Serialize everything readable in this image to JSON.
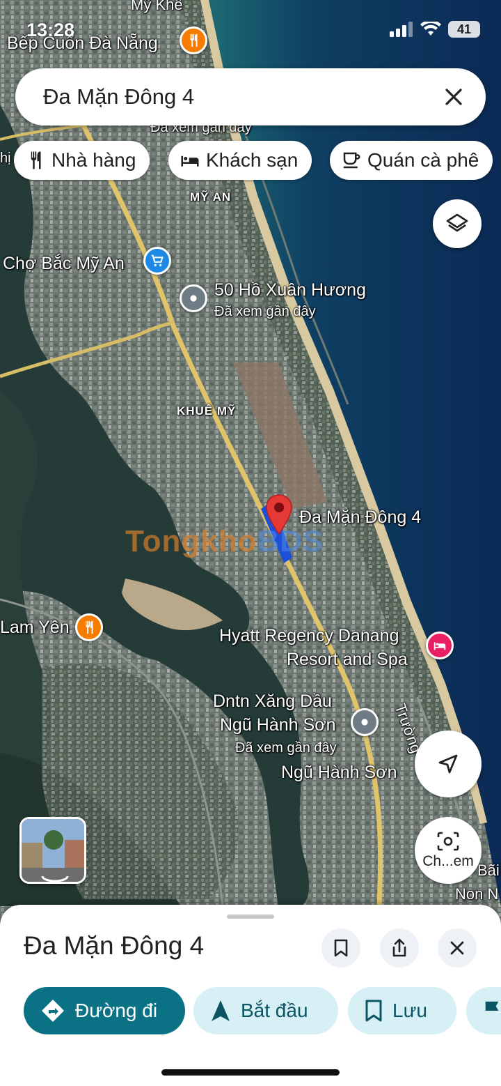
{
  "status_bar": {
    "time": "13:28",
    "battery": "41"
  },
  "search": {
    "query": "Đa Mặn Đông 4"
  },
  "chips": [
    {
      "label": "Nhà hàng",
      "icon": "restaurant-icon"
    },
    {
      "label": "Khách sạn",
      "icon": "hotel-icon"
    },
    {
      "label": "Quán cà phê",
      "icon": "coffee-icon"
    }
  ],
  "map": {
    "places": {
      "bep_cuon": "Bếp Cuốn Đà Nẵng",
      "my_khe": "Mỹ Khê",
      "cho_bac_my_an": "Chợ Bắc Mỹ An",
      "ho_xuan_huong": "50 Hồ Xuân Hương",
      "seen_recent": "Đã xem gần đây",
      "dropped_pin": "Đa Mặn Đông 4",
      "lam_yen": "Lam Yên",
      "hyatt_line1": "Hyatt Regency Danang",
      "hyatt_line2": "Resort and Spa",
      "xang_dau_line1": "Dntn Xăng Dầu",
      "xang_dau_line2": "Ngũ Hành Sơn",
      "ngu_hanh_son": "Ngũ Hành Sơn",
      "truong": "Trường",
      "bai": "Bãi",
      "non_n": "Non N",
      "partial_left": "hị"
    },
    "districts": {
      "my_an": "MỸ AN",
      "khue_my": "KHUÊ MỸ"
    },
    "watermark": {
      "part1": "Tongkho",
      "part2": "BDS"
    },
    "lens_label": "Ch...em"
  },
  "sheet": {
    "title": "Đa Mặn Đông 4",
    "actions": [
      {
        "label": "Đường đi",
        "icon": "directions-icon"
      },
      {
        "label": "Bắt đầu",
        "icon": "navigation-arrow-icon"
      },
      {
        "label": "Lưu",
        "icon": "bookmark-icon"
      }
    ]
  },
  "colors": {
    "accent": "#0b7285",
    "pin": "#e53935",
    "restaurant": "#f57c00",
    "shopping": "#1e88e5",
    "hotel": "#e91e63"
  }
}
